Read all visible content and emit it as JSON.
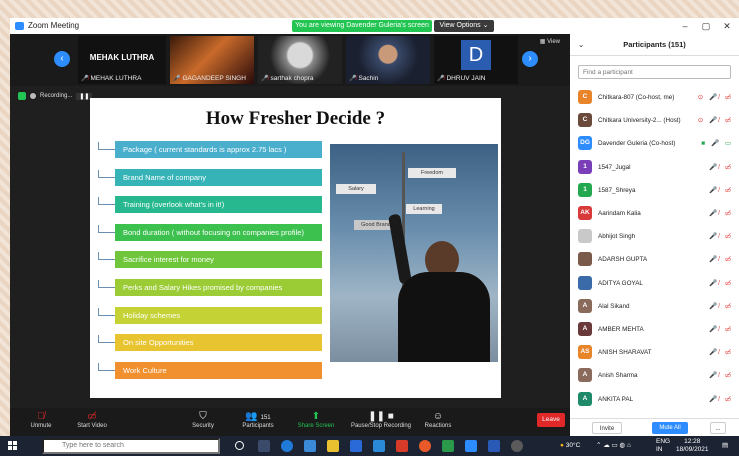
{
  "window": {
    "title": "Zoom Meeting",
    "viewing_banner": "You are viewing Davender Guleria's screen",
    "view_options": "View Options ⌄",
    "min": "–",
    "max": "▢",
    "close": "✕"
  },
  "strip": {
    "view_label": "View",
    "tiles": [
      {
        "name": "MEHAK LUTHRA",
        "label": "MEHAK LUTHRA"
      },
      {
        "name": "GAGANDEEP SINGH"
      },
      {
        "name": "sarthak chopra"
      },
      {
        "name": "Sachin"
      },
      {
        "name": "DHRUV JAIN",
        "initial": "D"
      }
    ],
    "prev": "‹",
    "next": "›"
  },
  "recording": {
    "label": "Recording...",
    "pause": "❚❚"
  },
  "slide": {
    "title": "How Fresher Decide ?",
    "items": [
      {
        "text": "Package ( current standards is approx 2.75 lacs )",
        "color": "#4aaecd"
      },
      {
        "text": "Brand Name of company",
        "color": "#35b3b7"
      },
      {
        "text": "Training (overlook what's in it!)",
        "color": "#27b88f"
      },
      {
        "text": "Bond duration ( without focusing on companies profile)",
        "color": "#3cc04e"
      },
      {
        "text": "Sacrifice interest for money",
        "color": "#6fc63a"
      },
      {
        "text": "Perks and Salary Hikes promised by companies",
        "color": "#9bcc35"
      },
      {
        "text": "Holiday schemes",
        "color": "#c4d236"
      },
      {
        "text": "On site Opportunities",
        "color": "#e8c430"
      },
      {
        "text": "Work Culture",
        "color": "#f0902e"
      }
    ],
    "signs": [
      "Freedom",
      "Salary",
      "Learning",
      "Good Brand"
    ]
  },
  "toolbar": {
    "unmute": "Unmute",
    "start_video": "Start Video",
    "security": "Security",
    "participants": "Participants",
    "participants_count": "151",
    "share_screen": "Share Screen",
    "pause_recording": "Pause/Stop Recording",
    "reactions": "Reactions",
    "leave": "Leave"
  },
  "panel": {
    "title": "Participants (151)",
    "collapse": "⌄",
    "search_placeholder": "Find a participant",
    "participants": [
      {
        "initials": "C",
        "name": "Chitkara-807 (Co-host, me)",
        "color": "#e8842a",
        "icons": "⊙ 🎤̸ ▭̸"
      },
      {
        "initials": "C",
        "name": "Chitkara University-2... (Host)",
        "color": "#6a4a3a",
        "icons": "⊙ 🎤̸ ▭̸"
      },
      {
        "initials": "DG",
        "name": "Davender Guleria (Co-host)",
        "color": "#2d8cff",
        "icons": "■ 🎤 ▭"
      },
      {
        "initials": "1",
        "name": "1547_Jugal",
        "color": "#7a3fb8",
        "icons": "🎤̸ ▭̸"
      },
      {
        "initials": "1",
        "name": "1587_Shreya",
        "color": "#23a84f",
        "icons": "🎤̸ ▭̸"
      },
      {
        "initials": "AK",
        "name": "Aarindam Kalia",
        "color": "#d83a3a",
        "icons": "🎤̸ ▭̸"
      },
      {
        "initials": "",
        "name": "Abhijot Singh",
        "color": "#c9c9c9",
        "icons": "🎤̸ ▭̸"
      },
      {
        "initials": "",
        "name": "ADARSH GUPTA",
        "color": "#7a5a4a",
        "icons": "🎤̸ ▭̸"
      },
      {
        "initials": "",
        "name": "ADITYA GOYAL",
        "color": "#3a6aa8",
        "icons": "🎤̸ ▭̸"
      },
      {
        "initials": "A",
        "name": "Alal Sikand",
        "color": "#8a6a5a",
        "icons": "🎤̸ ▭̸"
      },
      {
        "initials": "A",
        "name": "AMBER MEHTA",
        "color": "#6a3a3a",
        "icons": "🎤̸ ▭̸"
      },
      {
        "initials": "AS",
        "name": "ANISH SHARAVAT",
        "color": "#e8842a",
        "icons": "🎤̸ ▭̸"
      },
      {
        "initials": "A",
        "name": "Anish Sharma",
        "color": "#8a6a5a",
        "icons": "🎤̸ ▭̸"
      },
      {
        "initials": "A",
        "name": "ANKITA PAL",
        "color": "#1f8a6a",
        "icons": "🎤̸ ▭̸"
      }
    ],
    "invite": "Invite",
    "mute_all": "Mute All",
    "more": "..."
  },
  "taskbar": {
    "search_placeholder": "Type here to search",
    "weather": "30°C",
    "lang": "ENG",
    "region": "IN",
    "time": "12:28",
    "date": "18/09/2021"
  }
}
